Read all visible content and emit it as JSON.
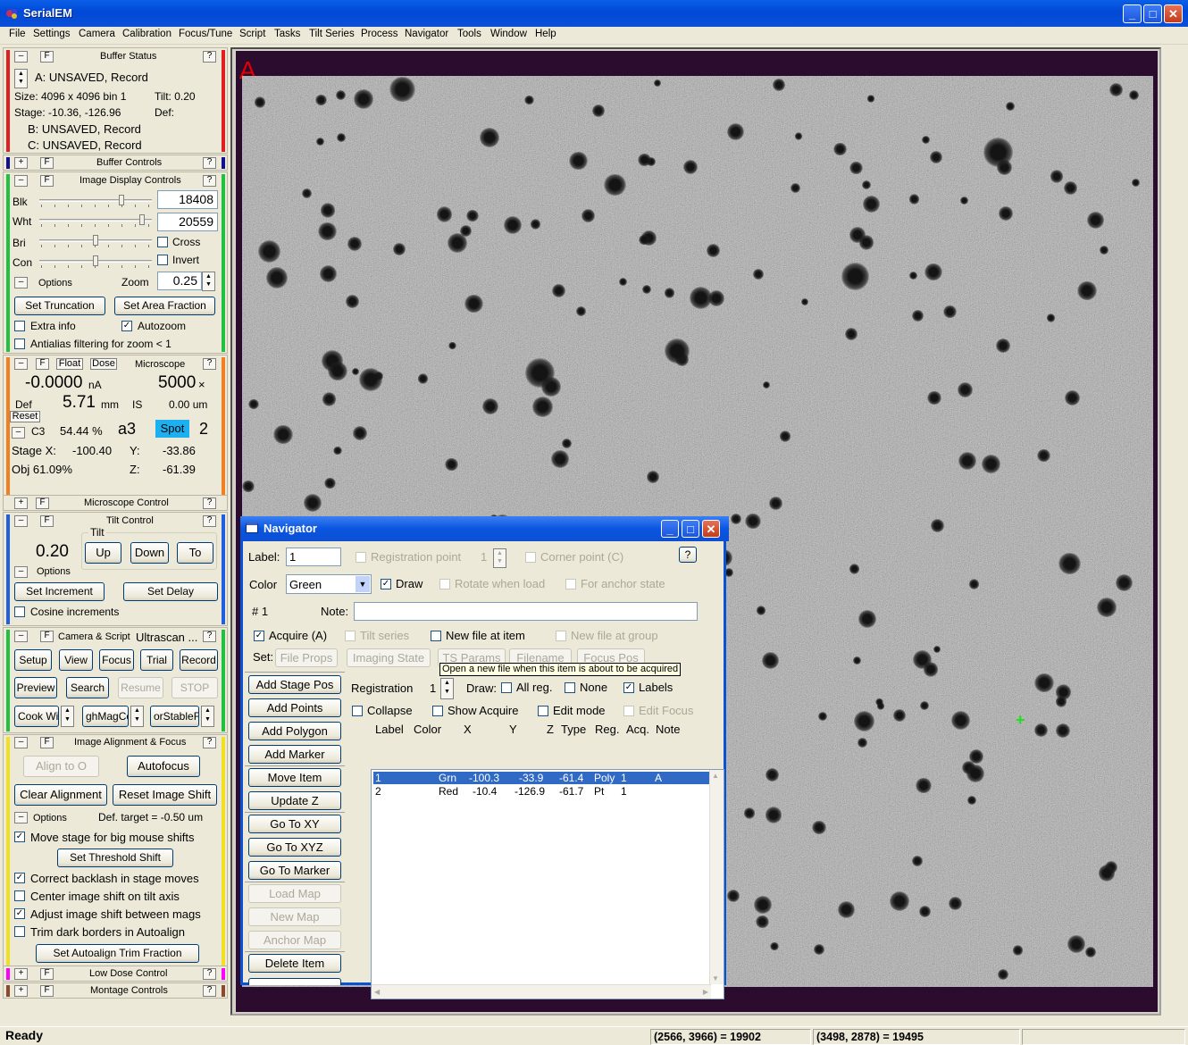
{
  "app": {
    "title": "SerialEM"
  },
  "menu": [
    "File",
    "Settings",
    "Camera",
    "Calibration",
    "Focus/Tune",
    "Script",
    "Tasks",
    "Tilt Series",
    "Process",
    "Navigator",
    "Tools",
    "Window",
    "Help"
  ],
  "buffer_status": {
    "header": "Buffer Status",
    "minus": "–",
    "f": "F",
    "help": "?",
    "a": "A: UNSAVED, Record",
    "size": "Size: 4096 x 4096  bin 1",
    "tilt": "Tilt: 0.20",
    "stage": "Stage: -10.36, -126.96",
    "def": "Def:",
    "b": "B: UNSAVED, Record",
    "c": "C: UNSAVED, Record"
  },
  "buffer_controls": {
    "header": "Buffer Controls",
    "plus": "+",
    "f": "F",
    "help": "?"
  },
  "image_display": {
    "header": "Image Display Controls",
    "minus": "–",
    "f": "F",
    "help": "?",
    "blk_label": "Blk",
    "blk_value": "18408",
    "wht_label": "Wht",
    "wht_value": "20559",
    "bri_label": "Bri",
    "con_label": "Con",
    "cross": "Cross",
    "invert": "Invert",
    "options": "Options",
    "zoom_label": "Zoom",
    "zoom_value": "0.25",
    "set_truncation": "Set Truncation",
    "set_area_fraction": "Set Area Fraction",
    "extra_info": "Extra info",
    "autozoom": "Autozoom",
    "antialias": "Antialias filtering for zoom < 1",
    "sliders": {
      "blk": 0.74,
      "wht": 0.93,
      "bri": 0.5,
      "con": 0.5
    }
  },
  "microscope": {
    "header": "Microscope",
    "minus": "–",
    "f": "F",
    "float": "Float",
    "dose": "Dose",
    "help": "?",
    "current": "-0.0000",
    "current_unit": "nA",
    "mag": "5000",
    "mag_unit": "×",
    "def_label": "Def",
    "def_value": "5.71",
    "def_unit": "mm",
    "is_label": "IS",
    "is_value": "0.00 um",
    "reset": "Reset",
    "c3_label": "C3",
    "c3_value": "54.44 %",
    "aperture": "a3",
    "spot_label": "Spot",
    "spot_value": "2",
    "stage_x_label": "Stage X:",
    "stage_x": "-100.40",
    "y_label": "Y:",
    "stage_y": "-33.86",
    "obj": "Obj  61.09%",
    "z_label": "Z:",
    "stage_z": "-61.39"
  },
  "microscope_control": {
    "header": "Microscope Control",
    "plus": "+",
    "f": "F",
    "help": "?"
  },
  "tilt_control": {
    "header": "Tilt Control",
    "minus": "–",
    "f": "F",
    "help": "?",
    "tilt_group": "Tilt",
    "angle": "0.20",
    "up": "Up",
    "down": "Down",
    "to": "To",
    "options": "Options",
    "set_increment": "Set Increment",
    "set_delay": "Set Delay",
    "cosine": "Cosine increments"
  },
  "camera_script": {
    "header": "Camera & Script",
    "camera": "Ultrascan ...",
    "minus": "–",
    "f": "F",
    "help": "?",
    "setup": "Setup",
    "view": "View",
    "focus": "Focus",
    "trial": "Trial",
    "record": "Record",
    "preview": "Preview",
    "search": "Search",
    "resume": "Resume",
    "stop": "STOP",
    "script1": "Cook Wit",
    "script2": "ghMagCo",
    "script3": "orStableFi"
  },
  "image_alignment": {
    "header": "Image Alignment & Focus",
    "minus": "–",
    "f": "F",
    "help": "?",
    "align_to": "Align to O",
    "autofocus": "Autofocus",
    "clear_alignment": "Clear Alignment",
    "reset_image_shift": "Reset Image Shift",
    "options": "Options",
    "def_target": "Def. target = -0.50 um",
    "move_stage": "Move stage for big mouse shifts",
    "set_threshold": "Set Threshold Shift",
    "correct_backlash": "Correct backlash in stage moves",
    "center_image_shift": "Center image shift on tilt axis",
    "adjust_image_shift": "Adjust image shift between mags",
    "trim_dark": "Trim dark borders in Autoalign",
    "set_trim": "Set Autoalign Trim Fraction"
  },
  "low_dose": {
    "header": "Low Dose Control",
    "plus": "+",
    "f": "F",
    "help": "?"
  },
  "montage": {
    "header": "Montage Controls",
    "plus": "+",
    "f": "F",
    "help": "?"
  },
  "image_view": {
    "buffer_letter": "A"
  },
  "navigator": {
    "title": "Navigator",
    "label_label": "Label:",
    "label_value": "1",
    "registration_point": "Registration point",
    "reg_point_value": "1",
    "corner_point": "Corner point (C)",
    "help": "?",
    "color_label": "Color",
    "color_value": "Green",
    "draw": "Draw",
    "rotate": "Rotate when load",
    "anchor": "For anchor state",
    "item_num": "# 1",
    "note_label": "Note:",
    "acquire": "Acquire (A)",
    "tilt_series": "Tilt series",
    "new_file_item": "New file at item",
    "new_file_group": "New file at group",
    "set_label": "Set:",
    "file_props": "File Props",
    "imaging_state": "Imaging State",
    "ts_params": "TS Params",
    "filename": "Filename",
    "focus_pos": "Focus Pos",
    "tooltip": "Open a new file when this item is about to be acquired",
    "add_stage_pos": "Add Stage Pos",
    "add_points": "Add Points",
    "add_polygon": "Add Polygon",
    "add_marker": "Add Marker",
    "move_item": "Move Item",
    "update_z": "Update Z",
    "go_to_xy": "Go To XY",
    "go_to_xyz": "Go To XYZ",
    "go_to_marker": "Go To Marker",
    "load_map": "Load Map",
    "new_map": "New Map",
    "anchor_map": "Anchor Map",
    "delete_item": "Delete Item",
    "registration_label": "Registration",
    "registration_value": "1",
    "draw_label": "Draw:",
    "all_reg": "All reg.",
    "none": "None",
    "labels": "Labels",
    "collapse": "Collapse",
    "show_acquire": "Show Acquire",
    "edit_mode": "Edit mode",
    "edit_focus": "Edit Focus",
    "columns": [
      "Label",
      "Color",
      "X",
      "Y",
      "Z",
      "Type",
      "Reg.",
      "Acq.",
      "Note"
    ],
    "rows": [
      {
        "label": "1",
        "color": "Grn",
        "x": "-100.3",
        "y": "-33.9",
        "z": "-61.4",
        "type": "Poly",
        "reg": "1",
        "acq": "A"
      },
      {
        "label": "2",
        "color": "Red",
        "x": "-10.4",
        "y": "-126.9",
        "z": "-61.7",
        "type": "Pt",
        "reg": "1",
        "acq": ""
      }
    ]
  },
  "status_bar": {
    "ready": "Ready",
    "pos1": "(2566, 3966) = 19902",
    "pos2": "(3498, 2878) = 19495"
  },
  "colors": {
    "title_blue": "#0a52d4",
    "image_border": "#2b0b2e",
    "bar_red": "#e02020",
    "bar_green": "#20c040",
    "bar_orange": "#f08020",
    "bar_blue": "#2060e0",
    "bar_yellow": "#f0e020",
    "bar_magenta": "#ff00ff",
    "bar_brown": "#8b4a2b",
    "bar_navy": "#101090",
    "marker_green": "#20e020"
  }
}
